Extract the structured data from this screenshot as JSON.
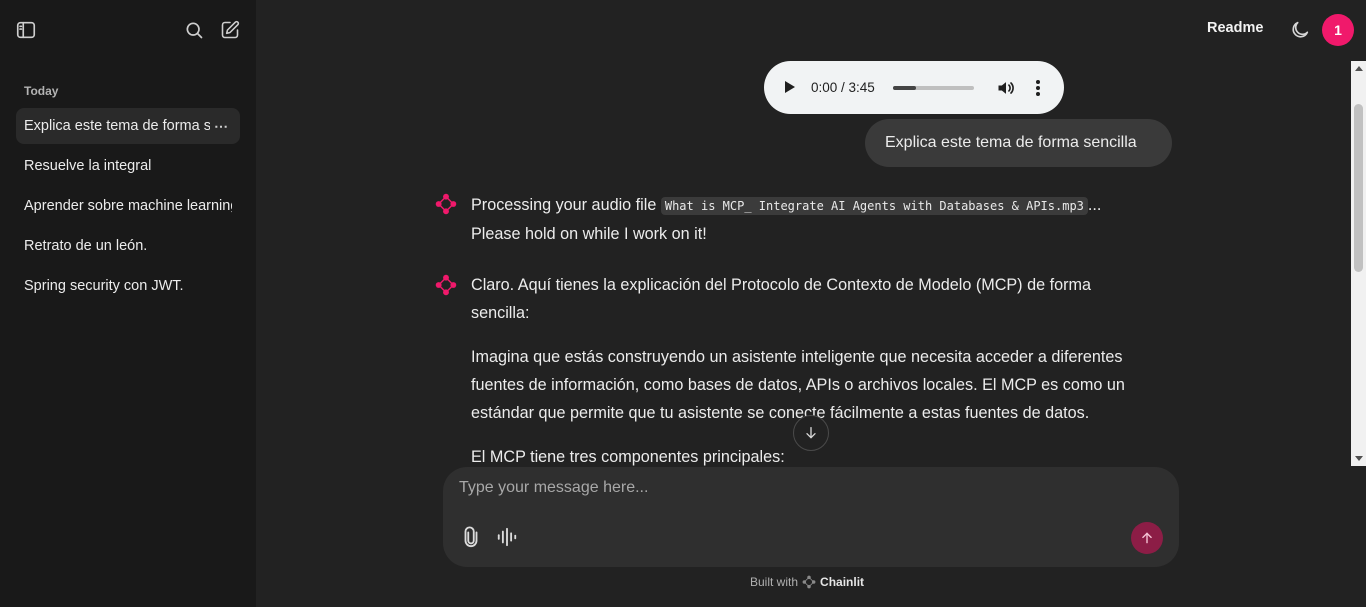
{
  "sidebar": {
    "section_label": "Today",
    "threads": [
      {
        "label": "Explica este tema de forma sencilla",
        "menu": "⋯"
      },
      {
        "label": "Resuelve la integral"
      },
      {
        "label": "Aprender sobre machine learning"
      },
      {
        "label": "Retrato de un león."
      },
      {
        "label": "Spring security con JWT."
      }
    ]
  },
  "header": {
    "readme_label": "Readme",
    "avatar_initial": "1",
    "avatar_color": "#f0196b"
  },
  "audio": {
    "time": "0:00 / 3:45",
    "progress_fraction": 0.28
  },
  "user_message": "Explica este tema de forma sencilla",
  "messages": {
    "processing_before": "Processing your audio file ",
    "processing_file": "What is MCP_ Integrate AI Agents with Databases & APIs.mp3",
    "processing_after": "...",
    "processing_line2": "Please hold on while I work on it!",
    "answer_p1": "Claro. Aquí tienes la explicación del Protocolo de Contexto de Modelo (MCP) de forma sencilla:",
    "answer_p2": "Imagina que estás construyendo un asistente inteligente que necesita acceder a diferentes fuentes de información, como bases de datos, APIs o archivos locales. El MCP es como un estándar que permite que tu asistente se conecte fácilmente a estas fuentes de datos.",
    "answer_p3": "El MCP tiene tres componentes principales:"
  },
  "composer": {
    "placeholder": "Type your message here..."
  },
  "footer": {
    "built_with": "Built with",
    "brand": "Chainlit"
  },
  "colors": {
    "accent": "#f0196b",
    "send_button": "#8c1d46"
  }
}
